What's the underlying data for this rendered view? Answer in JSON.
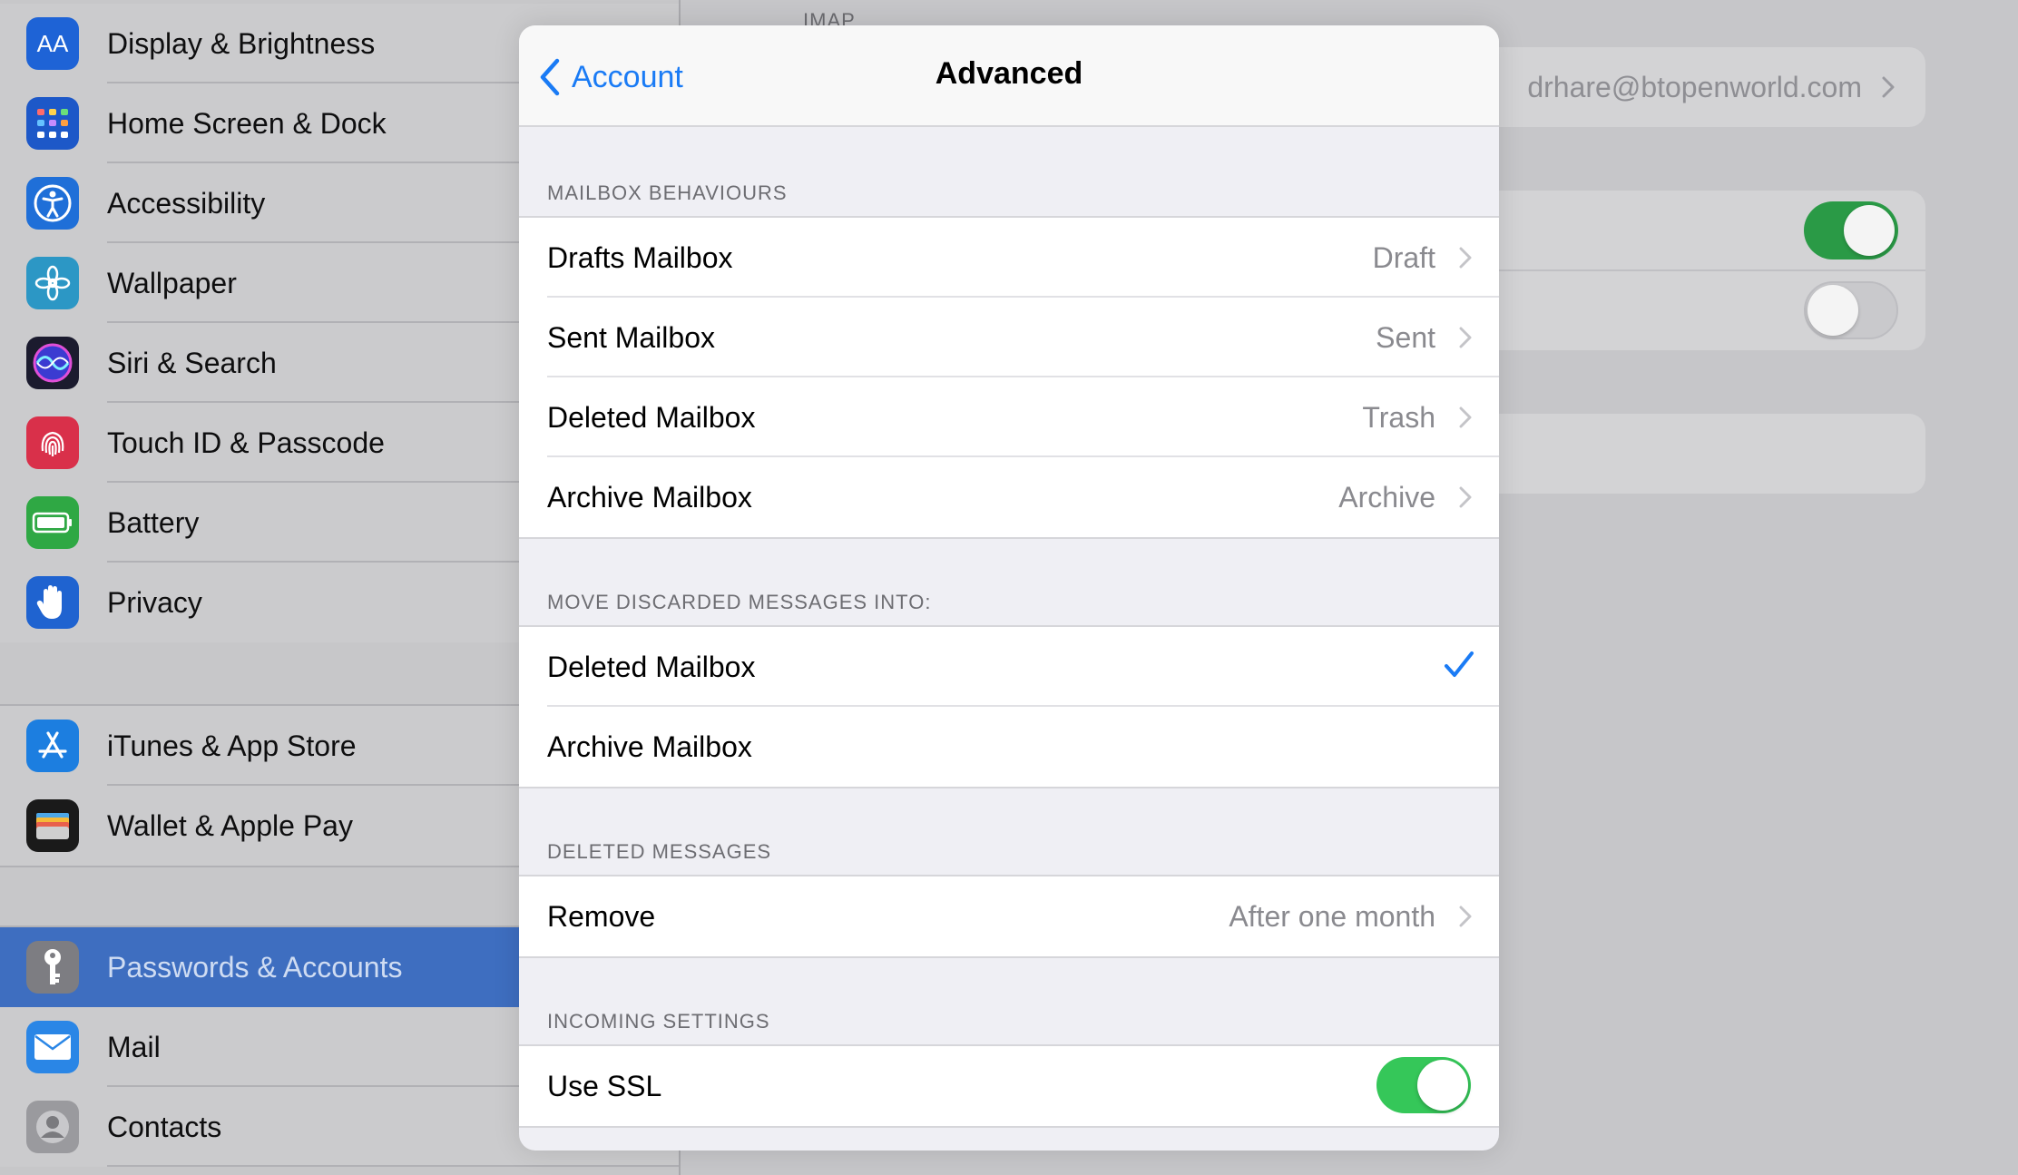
{
  "sidebar": {
    "group1": [
      {
        "label": "Display & Brightness",
        "icon": "display-brightness-icon",
        "color": "#1e63d6",
        "glyph": "AA"
      },
      {
        "label": "Home Screen & Dock",
        "icon": "home-screen-icon",
        "color": "#1d58c8",
        "glyph": ""
      },
      {
        "label": "Accessibility",
        "icon": "accessibility-icon",
        "color": "#1f6fd8",
        "glyph": ""
      },
      {
        "label": "Wallpaper",
        "icon": "wallpaper-icon",
        "color": "#2c97c5",
        "glyph": ""
      },
      {
        "label": "Siri & Search",
        "icon": "siri-icon",
        "color": "#1b1b2e",
        "glyph": ""
      },
      {
        "label": "Touch ID & Passcode",
        "icon": "fingerprint-icon",
        "color": "#d9304a",
        "glyph": ""
      },
      {
        "label": "Battery",
        "icon": "battery-icon",
        "color": "#2fa844",
        "glyph": ""
      },
      {
        "label": "Privacy",
        "icon": "privacy-hand-icon",
        "color": "#1f63d0",
        "glyph": ""
      }
    ],
    "group2": [
      {
        "label": "iTunes & App Store",
        "icon": "app-store-icon",
        "color": "#1c7ee0",
        "glyph": ""
      },
      {
        "label": "Wallet & Apple Pay",
        "icon": "wallet-icon",
        "color": "#1a1a1a",
        "glyph": ""
      }
    ],
    "group3": [
      {
        "label": "Passwords & Accounts",
        "icon": "key-icon",
        "color": "#7d7d82",
        "glyph": "",
        "selected": true
      },
      {
        "label": "Mail",
        "icon": "mail-icon",
        "color": "#2a86e6",
        "glyph": ""
      },
      {
        "label": "Contacts",
        "icon": "contacts-icon",
        "color": "#9a9a9e",
        "glyph": ""
      }
    ]
  },
  "detail": {
    "section_label": "IMAP",
    "account_email": "drhare@btopenworld.com"
  },
  "sheet": {
    "back_label": "Account",
    "title": "Advanced",
    "sections": [
      {
        "header": "MAILBOX BEHAVIOURS",
        "rows": [
          {
            "label": "Drafts Mailbox",
            "value": "Draft"
          },
          {
            "label": "Sent Mailbox",
            "value": "Sent"
          },
          {
            "label": "Deleted Mailbox",
            "value": "Trash"
          },
          {
            "label": "Archive Mailbox",
            "value": "Archive"
          }
        ]
      },
      {
        "header": "MOVE DISCARDED MESSAGES INTO:",
        "rows": [
          {
            "label": "Deleted Mailbox",
            "checked": true
          },
          {
            "label": "Archive Mailbox",
            "checked": false
          }
        ]
      },
      {
        "header": "DELETED MESSAGES",
        "rows": [
          {
            "label": "Remove",
            "value": "After one month"
          }
        ]
      },
      {
        "header": "INCOMING SETTINGS",
        "rows": [
          {
            "label": "Use SSL",
            "toggle": true
          }
        ]
      }
    ]
  },
  "colors": {
    "accent": "#1a7bf5",
    "switch_on": "#35c759",
    "selected_row": "#3e6ec0"
  }
}
